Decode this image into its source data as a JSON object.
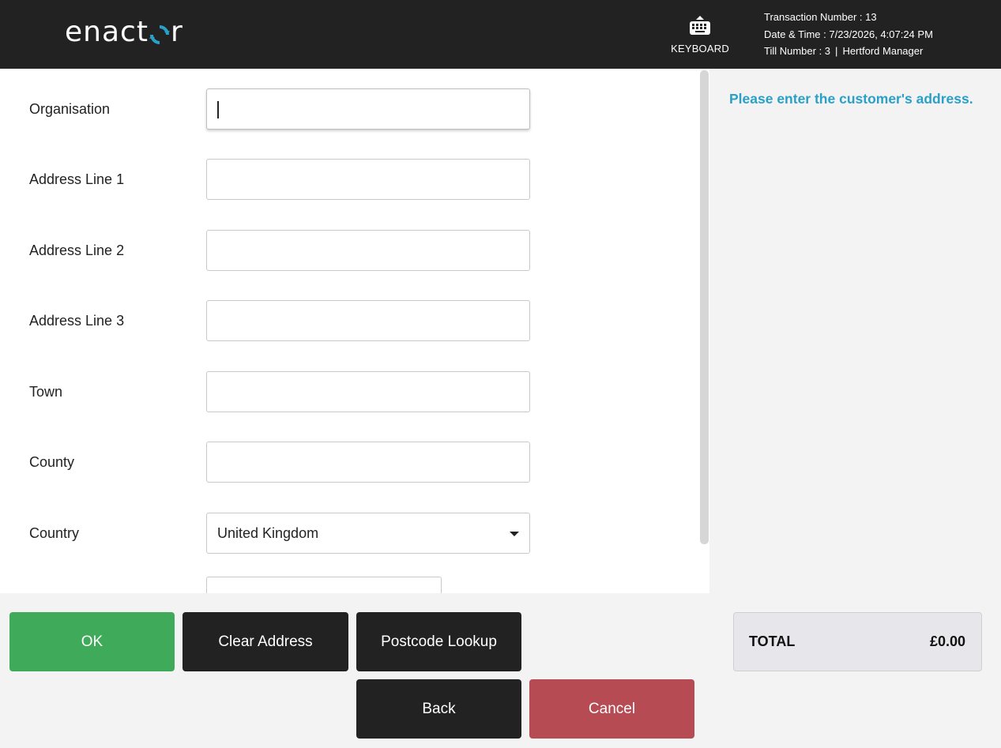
{
  "header": {
    "logo": {
      "prefix": "enact",
      "suffix": "r",
      "colors": {
        "text": "#ffffff",
        "accent": "#2aa0c8"
      }
    },
    "keyboard_button": {
      "label": "KEYBOARD",
      "icon": "keyboard-icon"
    },
    "transaction_number": "Transaction Number : 13",
    "date_time": "Date & Time : 7/23/2026, 4:07:24 PM",
    "till_number": "Till Number : 3",
    "separator": "|",
    "user": "Hertford Manager"
  },
  "form": {
    "fields": [
      {
        "label": "Organisation",
        "value": "",
        "focused": true
      },
      {
        "label": "Address Line 1",
        "value": ""
      },
      {
        "label": "Address Line 2",
        "value": ""
      },
      {
        "label": "Address Line 3",
        "value": ""
      },
      {
        "label": "Town",
        "value": ""
      },
      {
        "label": "County",
        "value": ""
      },
      {
        "label": "Country",
        "value": "United Kingdom",
        "type": "select"
      }
    ]
  },
  "prompt": {
    "text": "Please enter the customer's address."
  },
  "buttons": {
    "ok": "OK",
    "clear_address": "Clear Address",
    "postcode_lookup": "Postcode Lookup",
    "back": "Back",
    "cancel": "Cancel"
  },
  "total": {
    "label": "TOTAL",
    "value": "£0.00"
  },
  "colors": {
    "header_bg": "#222222",
    "ok": "#3fab5a",
    "cancel": "#b64b54",
    "dark_button": "#222222",
    "prompt": "#2aa0c8"
  }
}
